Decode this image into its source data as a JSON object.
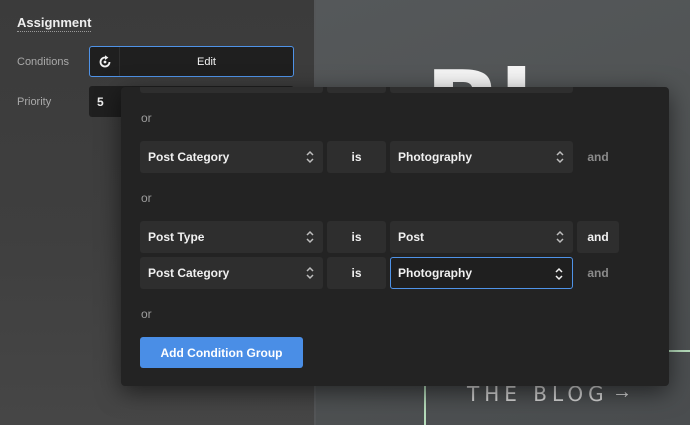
{
  "assignment": {
    "title": "Assignment",
    "conditions_label": "Conditions",
    "edit_label": "Edit",
    "priority_label": "Priority",
    "priority_value": "5"
  },
  "preview": {
    "hero_text": "Bl",
    "blog_link": "THE BLOG",
    "arrow": "→"
  },
  "popup": {
    "or_label": "or",
    "groups": [
      {
        "conditions": [
          {
            "field": "Post Category",
            "operator": "is",
            "value": "Photography",
            "connector": "and",
            "connector_active": false
          }
        ]
      },
      {
        "conditions": [
          {
            "field": "Post Type",
            "operator": "is",
            "value": "Post",
            "connector": "and",
            "connector_active": true
          },
          {
            "field": "Post Category",
            "operator": "is",
            "value": "Photography",
            "connector": "and",
            "connector_active": false
          }
        ]
      }
    ],
    "add_group_label": "Add Condition Group"
  },
  "colors": {
    "accent": "#4a8ee6",
    "focus_border": "#4f93e8",
    "popup_bg": "#232323",
    "control_bg": "#2e2e2e",
    "hero_border": "#b6ddbc"
  }
}
